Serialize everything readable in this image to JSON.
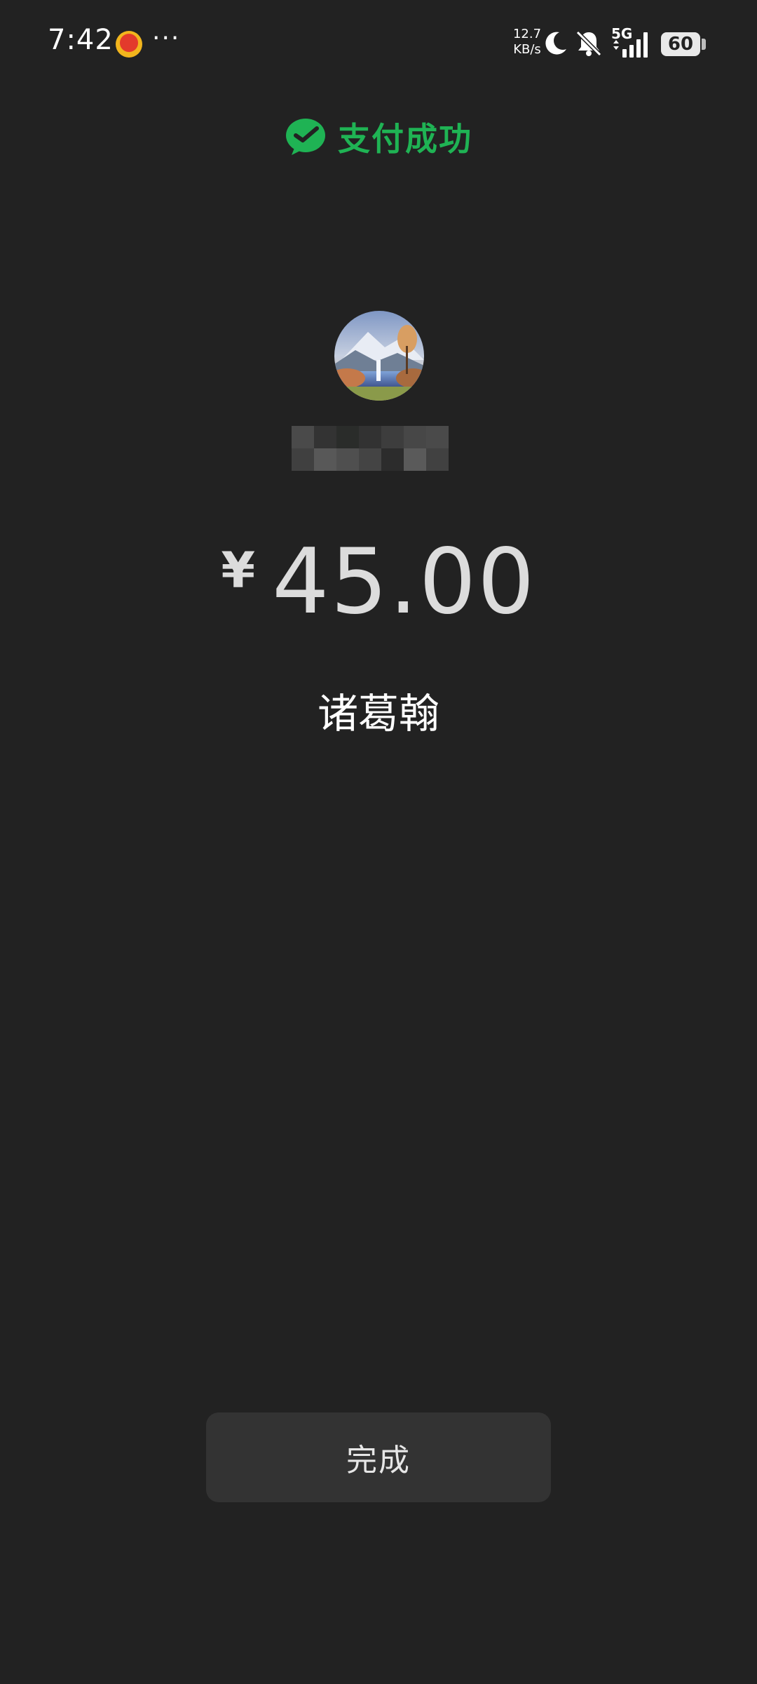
{
  "status_bar": {
    "time": "7:42",
    "more": "···",
    "net_speed_value": "12.7",
    "net_speed_unit": "KB/s",
    "network_type": "5G",
    "battery": "60"
  },
  "header": {
    "title": "支付成功",
    "icon": "wechat-pay-icon",
    "accent_color": "#1fb354"
  },
  "payment": {
    "currency_symbol": "¥",
    "amount": "45.00",
    "payee": "诸葛翰"
  },
  "actions": {
    "done_label": "完成"
  }
}
